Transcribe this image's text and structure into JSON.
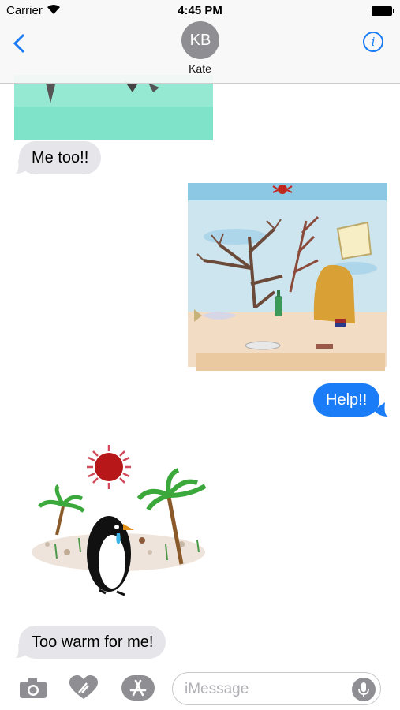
{
  "status_bar": {
    "carrier": "Carrier",
    "time": "4:45 PM"
  },
  "nav": {
    "avatar_initials": "KB",
    "contact_name": "Kate",
    "info_glyph": "i"
  },
  "messages": [
    {
      "from": "them",
      "kind": "sticker",
      "description_icon": "water-scene-sticker"
    },
    {
      "from": "them",
      "kind": "text",
      "text": "Me too!!"
    },
    {
      "from": "me",
      "kind": "sticker",
      "description_icon": "polluted-reef-sticker"
    },
    {
      "from": "me",
      "kind": "text",
      "text": "Help!!"
    },
    {
      "from": "them",
      "kind": "sticker",
      "description_icon": "crying-penguin-sticker"
    },
    {
      "from": "them",
      "kind": "text",
      "text": "Too warm for me!"
    }
  ],
  "compose": {
    "placeholder": "iMessage"
  },
  "colors": {
    "accent": "#1a7cf6",
    "incoming_bubble": "#e5e5ea",
    "sun": "#b8171a"
  }
}
